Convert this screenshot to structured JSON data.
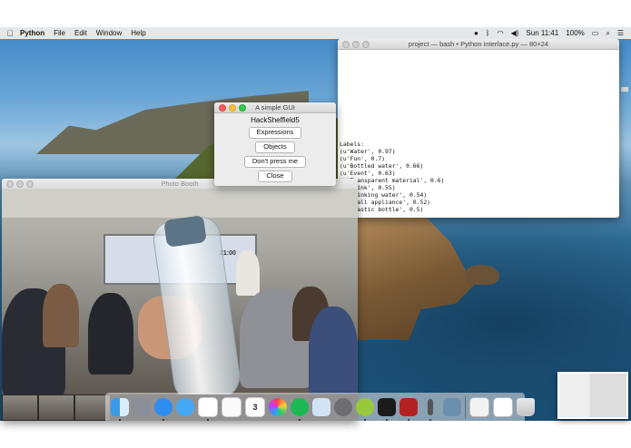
{
  "menubar": {
    "app_name": "Python",
    "items": [
      "File",
      "Edit",
      "Window",
      "Help"
    ],
    "clock": "Sun 11:41",
    "battery": "100%"
  },
  "terminal": {
    "title": "project — bash • Python interface.py — 80×24",
    "lines": [
      "Labels:",
      "(u'Water', 0.97)",
      "(u'Fun', 0.7)",
      "(u'Bottled water', 0.66)",
      "(u'Event', 0.63)",
      "(u'Transparent material', 0.6)",
      "(u'Drink', 0.55)",
      "(u'Drinking water', 0.54)",
      "(u'Small appliance', 0.52)",
      "(u'Plastic bottle', 0.5)"
    ]
  },
  "gui": {
    "title": "A simple GUI",
    "heading": "HackSheffield5",
    "buttons": [
      "Expressions",
      "Objects",
      "Don't press me",
      "Close"
    ]
  },
  "photobooth": {
    "title": "Photo Booth",
    "board_text": "21:00"
  },
  "dock": {
    "apps": [
      "Finder",
      "Launchpad",
      "Safari",
      "Messages",
      "Slack",
      "Reminders",
      "Calendar",
      "Photos",
      "Spotify",
      "Preview",
      "System Preferences",
      "Android File Transfer",
      "Terminal",
      "Photo Booth",
      "Python",
      "Image Capture",
      "Documents",
      "Activity",
      "Trash"
    ],
    "calendar_day": "3"
  }
}
